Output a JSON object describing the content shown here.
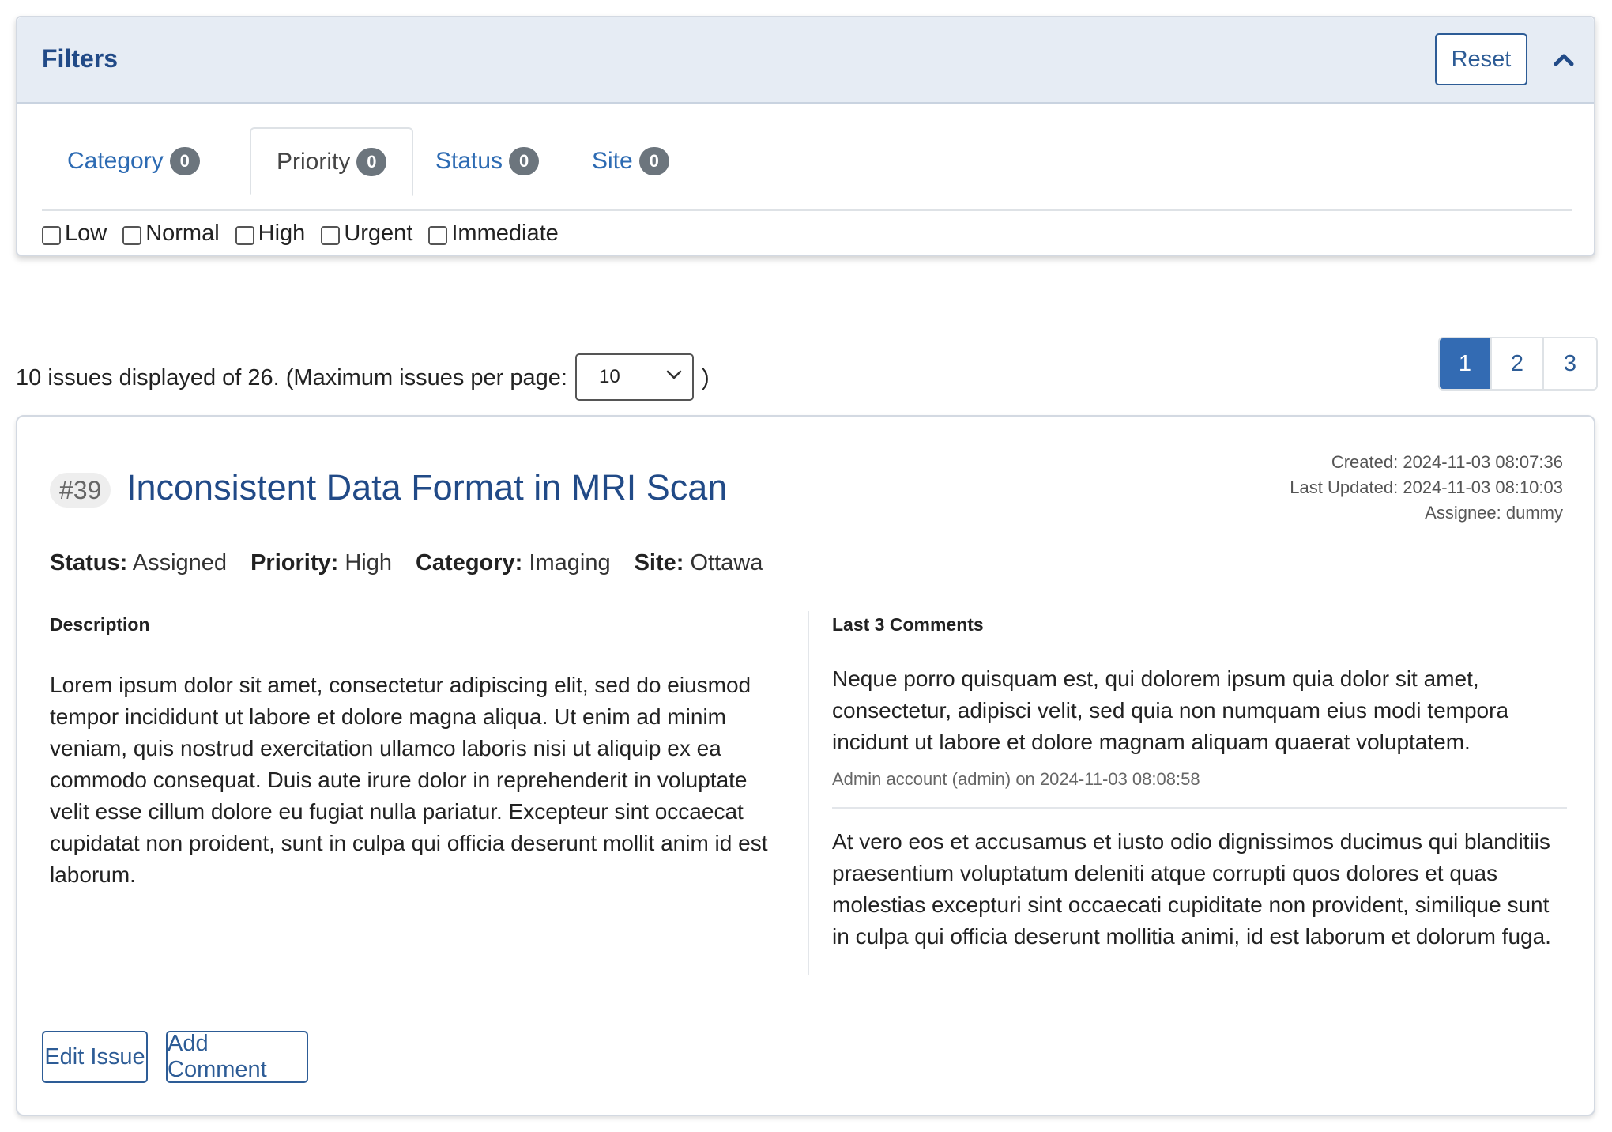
{
  "filters": {
    "title": "Filters",
    "reset_label": "Reset",
    "tabs": [
      {
        "label": "Category",
        "count": "0"
      },
      {
        "label": "Priority",
        "count": "0"
      },
      {
        "label": "Status",
        "count": "0"
      },
      {
        "label": "Site",
        "count": "0"
      }
    ],
    "active_tab": "Priority",
    "priority_options": [
      "Low",
      "Normal",
      "High",
      "Urgent",
      "Immediate"
    ]
  },
  "summary": {
    "text": "10 issues displayed of 26. (Maximum issues per page:",
    "per_page_value": "10",
    "closing_paren": ")"
  },
  "pagination": {
    "pages": [
      "1",
      "2",
      "3"
    ],
    "current": "1"
  },
  "issue": {
    "number": "#39",
    "title": "Inconsistent Data Format in MRI Scan",
    "created": "Created: 2024-11-03 08:07:36",
    "last_updated": "Last Updated: 2024-11-03 08:10:03",
    "assignee": "Assignee: dummy",
    "status_label": "Status:",
    "status_value": "Assigned",
    "priority_label": "Priority:",
    "priority_value": "High",
    "category_label": "Category:",
    "category_value": "Imaging",
    "site_label": "Site:",
    "site_value": "Ottawa",
    "description_heading": "Description",
    "description": "Lorem ipsum dolor sit amet, consectetur adipiscing elit, sed do eiusmod tempor incididunt ut labore et dolore magna aliqua. Ut enim ad minim veniam, quis nostrud exercitation ullamco laboris nisi ut aliquip ex ea commodo consequat. Duis aute irure dolor in reprehenderit in voluptate velit esse cillum dolore eu fugiat nulla pariatur. Excepteur sint occaecat cupidatat non proident, sunt in culpa qui officia deserunt mollit anim id est laborum.",
    "comments_heading": "Last 3 Comments",
    "comments": [
      {
        "text": "Neque porro quisquam est, qui dolorem ipsum quia dolor sit amet, consectetur, adipisci velit, sed quia non numquam eius modi tempora incidunt ut labore et dolore magnam aliquam quaerat voluptatem.",
        "meta": "Admin account (admin) on 2024-11-03 08:08:58"
      },
      {
        "text": "At vero eos et accusamus et iusto odio dignissimos ducimus qui blanditiis praesentium voluptatum deleniti atque corrupti quos dolores et quas molestias excepturi sint occaecati cupiditate non provident, similique sunt in culpa qui officia deserunt mollitia animi, id est laborum et dolorum fuga."
      }
    ],
    "edit_label": "Edit Issue",
    "add_comment_label": "Add Comment"
  },
  "colors": {
    "accent": "#2d5c96",
    "title_blue": "#214a87",
    "page_active": "#336bb3",
    "badge": "#6c757d"
  },
  "icons": {
    "collapse": "chevron-up-icon",
    "select_caret": "chevron-down-icon"
  }
}
